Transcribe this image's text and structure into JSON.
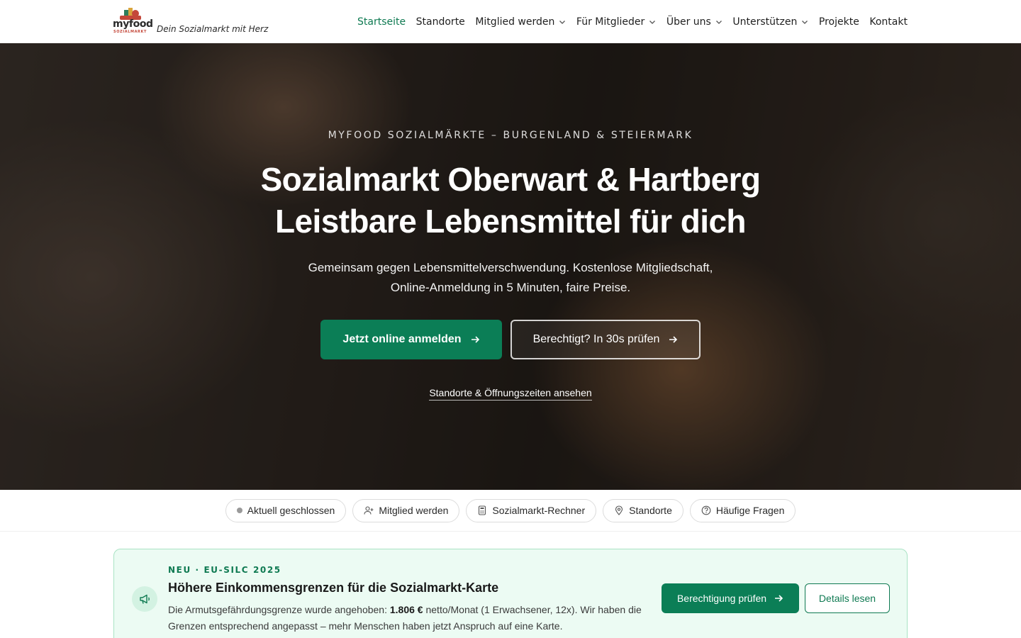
{
  "header": {
    "logo_word": "myfood",
    "logo_sub": "SOZIALMARKT",
    "tagline": "Dein Sozialmarkt mit Herz",
    "nav": [
      {
        "label": "Startseite",
        "active": true,
        "dropdown": false
      },
      {
        "label": "Standorte",
        "active": false,
        "dropdown": false
      },
      {
        "label": "Mitglied werden",
        "active": false,
        "dropdown": true
      },
      {
        "label": "Für Mitglieder",
        "active": false,
        "dropdown": true
      },
      {
        "label": "Über uns",
        "active": false,
        "dropdown": true
      },
      {
        "label": "Unterstützen",
        "active": false,
        "dropdown": true
      },
      {
        "label": "Projekte",
        "active": false,
        "dropdown": false
      },
      {
        "label": "Kontakt",
        "active": false,
        "dropdown": false
      }
    ]
  },
  "hero": {
    "eyebrow": "MYFOOD SOZIALMÄRKTE – BURGENLAND & STEIERMARK",
    "title_line1": "Sozialmarkt Oberwart & Hartberg",
    "title_line2": "Leistbare Lebensmittel für dich",
    "subtitle_line1": "Gemeinsam gegen Lebensmittelverschwendung. Kostenlose Mitgliedschaft,",
    "subtitle_line2": "Online-Anmeldung in 5 Minuten, faire Preise.",
    "primary_button": "Jetzt online anmelden",
    "secondary_button": "Berechtigt? In 30s prüfen",
    "link": "Standorte & Öffnungszeiten ansehen"
  },
  "quickbar": {
    "items": [
      {
        "label": "Aktuell geschlossen",
        "icon": "status-dot"
      },
      {
        "label": "Mitglied werden",
        "icon": "user-plus-icon"
      },
      {
        "label": "Sozialmarkt-Rechner",
        "icon": "calculator-icon"
      },
      {
        "label": "Standorte",
        "icon": "map-pin-icon"
      },
      {
        "label": "Häufige Fragen",
        "icon": "help-circle-icon"
      }
    ]
  },
  "notice": {
    "icon": "megaphone-icon",
    "eyebrow": "NEU · EU-SILC 2025",
    "title": "Höhere Einkommensgrenzen für die Sozialmarkt-Karte",
    "text_before": "Die Armutsgefährdungsgrenze wurde angehoben: ",
    "text_bold": "1.806 €",
    "text_after": " netto/Monat (1 Erwachsener, 12x). Wir haben die Grenzen entsprechend angepasst – mehr Menschen haben jetzt Anspruch auf eine Karte.",
    "button_primary": "Berechtigung prüfen",
    "button_secondary": "Details lesen"
  },
  "colors": {
    "brand_green": "#0b7e56",
    "notice_bg": "#ecfbf3",
    "notice_border": "#a9e3c4",
    "logo_red": "#c4483a"
  }
}
